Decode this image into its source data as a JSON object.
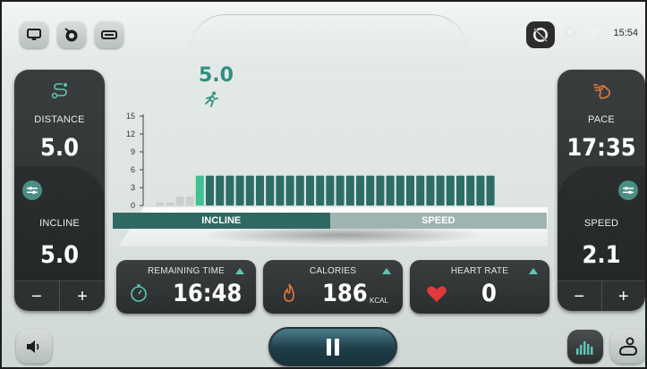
{
  "status": {
    "time": "15:54"
  },
  "top_buttons": [
    "screen-cast-icon",
    "coach-icon",
    "display-icon"
  ],
  "hr_badge_icon": "no-heart-rate-icon",
  "left_panel": {
    "top_label": "DISTANCE",
    "top_value": "5.0",
    "bottom_label": "INCLINE",
    "bottom_value": "5.0",
    "minus": "−",
    "plus": "+"
  },
  "right_panel": {
    "top_label": "PACE",
    "top_value": "17:35",
    "bottom_label": "SPEED",
    "bottom_value": "2.1",
    "minus": "−",
    "plus": "+"
  },
  "chart": {
    "current_value": "5.0",
    "tabs": {
      "incline": "INCLINE",
      "speed": "SPEED"
    }
  },
  "chart_data": {
    "type": "bar",
    "y_ticks": [
      0,
      3,
      6,
      9,
      12,
      15
    ],
    "ylim": [
      0,
      15
    ],
    "values": [
      0.5,
      0.5,
      1.5,
      1.5,
      5,
      5,
      5,
      5,
      5,
      5,
      5,
      5,
      5,
      5,
      5,
      5,
      5,
      5,
      5,
      5,
      5,
      5,
      5,
      5,
      5,
      5,
      5,
      5,
      5,
      5,
      5,
      5,
      5,
      5
    ],
    "colors": {
      "past": "#c8cfcd",
      "current": "#3fbf93",
      "upcoming": "#2c6d67"
    },
    "current_index": 4
  },
  "metrics": {
    "remaining_time": {
      "label": "REMAINING TIME",
      "value": "16:48"
    },
    "calories": {
      "label": "CALORIES",
      "value": "186",
      "unit": "KCAL"
    },
    "heart_rate": {
      "label": "HEART RATE",
      "value": "0"
    }
  },
  "colors": {
    "accent": "#2f8f80",
    "panel": "#2d3030",
    "calories_icon": "#e07a3c",
    "heart": "#e0393c"
  }
}
